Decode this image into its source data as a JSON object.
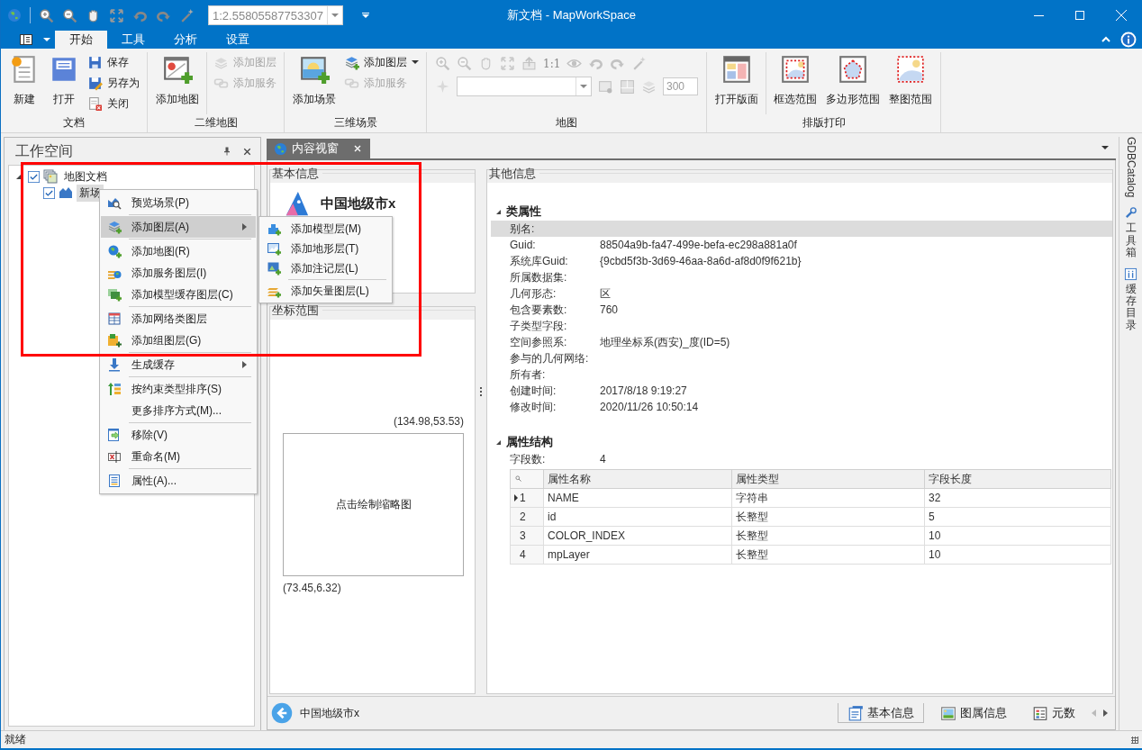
{
  "window": {
    "title": "新文档 - MapWorkSpace"
  },
  "quick_access": {
    "scale": "1:2.55805587753307"
  },
  "ribbon": {
    "tabs": [
      {
        "label": "开始",
        "selected": true
      },
      {
        "label": "工具",
        "selected": false
      },
      {
        "label": "分析",
        "selected": false
      },
      {
        "label": "设置",
        "selected": false
      }
    ],
    "groups": [
      {
        "title": "文档",
        "kind": "buttons",
        "items": [
          {
            "label": "新建",
            "kind": "large",
            "disabled": false,
            "dropdown": false
          },
          {
            "label": "打开",
            "kind": "large",
            "disabled": false,
            "dropdown": false
          },
          {
            "label": "保存",
            "kind": "small",
            "disabled": false,
            "dropdown": false
          },
          {
            "label": "另存为",
            "kind": "small",
            "disabled": false,
            "dropdown": false
          },
          {
            "label": "关闭",
            "kind": "small",
            "disabled": false,
            "dropdown": false
          }
        ]
      },
      {
        "title": "二维地图",
        "kind": "buttons",
        "items": [
          {
            "label": "添加地图",
            "kind": "large",
            "disabled": false,
            "dropdown": false
          },
          {
            "label": "添加图层",
            "kind": "small",
            "disabled": true,
            "dropdown": false
          },
          {
            "label": "添加服务",
            "kind": "small",
            "disabled": true,
            "dropdown": false
          }
        ]
      },
      {
        "title": "三维场景",
        "kind": "buttons",
        "items": [
          {
            "label": "添加场景",
            "kind": "large",
            "disabled": false,
            "dropdown": false
          },
          {
            "label": "添加图层",
            "kind": "small",
            "disabled": false,
            "dropdown": true
          },
          {
            "label": "添加服务",
            "kind": "small",
            "disabled": true,
            "dropdown": false
          }
        ]
      },
      {
        "title": "地图",
        "kind": "tools",
        "ratio_label": "1:1",
        "field_value": "300",
        "disabled": true
      },
      {
        "title": "排版打印",
        "kind": "buttons",
        "items": [
          {
            "label": "打开版面",
            "kind": "large",
            "disabled": false,
            "dropdown": false
          },
          {
            "label": "框选范围",
            "kind": "large",
            "disabled": false,
            "dropdown": false
          },
          {
            "label": "多边形范围",
            "kind": "large",
            "disabled": false,
            "dropdown": false
          },
          {
            "label": "整图范围",
            "kind": "large",
            "disabled": false,
            "dropdown": false
          }
        ]
      }
    ]
  },
  "workspace": {
    "title": "工作空间",
    "tree": [
      {
        "label": "地图文档",
        "checked": true,
        "expanded": true,
        "selected": false,
        "children": [
          {
            "label": "新场",
            "checked": true,
            "selected": true
          }
        ]
      }
    ]
  },
  "context_menu": {
    "groups": [
      [
        {
          "label": "预览场景(P)",
          "selected": false,
          "submenu": false
        }
      ],
      [
        {
          "label": "添加图层(A)",
          "selected": true,
          "submenu": true
        }
      ],
      [
        {
          "label": "添加地图(R)",
          "selected": false,
          "submenu": false
        },
        {
          "label": "添加服务图层(I)",
          "selected": false,
          "submenu": false
        },
        {
          "label": "添加模型缓存图层(C)",
          "selected": false,
          "submenu": false
        }
      ],
      [
        {
          "label": "添加网络类图层",
          "selected": false,
          "submenu": false
        },
        {
          "label": "添加组图层(G)",
          "selected": false,
          "submenu": false
        }
      ],
      [
        {
          "label": "生成缓存",
          "selected": false,
          "submenu": true
        }
      ],
      [
        {
          "label": "按约束类型排序(S)",
          "selected": false,
          "submenu": false
        },
        {
          "label": "更多排序方式(M)...",
          "selected": false,
          "submenu": false
        }
      ],
      [
        {
          "label": "移除(V)",
          "selected": false,
          "submenu": false
        },
        {
          "label": "重命名(M)",
          "selected": false,
          "submenu": false
        }
      ],
      [
        {
          "label": "属性(A)...",
          "selected": false,
          "submenu": false
        }
      ]
    ]
  },
  "submenu": {
    "groups": [
      [
        {
          "label": "添加模型层(M)",
          "selected": false
        },
        {
          "label": "添加地形层(T)",
          "selected": false
        },
        {
          "label": "添加注记层(L)",
          "selected": false
        }
      ],
      [
        {
          "label": "添加矢量图层(L)",
          "selected": false
        }
      ]
    ]
  },
  "content_view": {
    "tab": {
      "label": "内容视窗",
      "selected": true
    },
    "basic_info": {
      "title": "基本信息",
      "name": "中国地级市x"
    },
    "extent": {
      "title": "坐标范围",
      "max": "(134.98,53.53)",
      "thumbnail_button": "点击绘制缩略图",
      "min": "(73.45,6.32)"
    },
    "other_info": {
      "title": "其他信息",
      "sections": [
        {
          "title": "类属性",
          "expanded": true,
          "rows": [
            {
              "label": "别名:",
              "selected": true
            },
            {
              "label": "Guid:",
              "value": "88504a9b-fa47-499e-befa-ec298a881a0f",
              "selected": false
            },
            {
              "label": "系统库Guid:",
              "value": "{9cbd5f3b-3d69-46aa-8a6d-af8d0f9f621b}",
              "selected": false
            },
            {
              "label": "所属数据集:",
              "selected": false
            },
            {
              "label": "几何形态:",
              "value": "区",
              "selected": false
            },
            {
              "label": "包含要素数:",
              "value": "760",
              "selected": false
            },
            {
              "label": "子类型字段:",
              "selected": false
            },
            {
              "label": "空间参照系:",
              "value": "地理坐标系(西安)_度(ID=5)",
              "selected": false
            },
            {
              "label": "参与的几何网络:",
              "selected": false
            },
            {
              "label": "所有者:",
              "selected": false
            },
            {
              "label": "创建时间:",
              "value": "2017/8/18 9:19:27",
              "selected": false
            },
            {
              "label": "修改时间:",
              "value": "2020/11/26 10:50:14",
              "selected": false
            }
          ]
        },
        {
          "title": "属性结构",
          "expanded": true,
          "rows": [
            {
              "label": "字段数:",
              "value": "4",
              "selected": false
            }
          ],
          "table": {
            "columns": [
              "属性名称",
              "属性类型",
              "字段长度"
            ],
            "rows": [
              {
                "index": "1",
                "current": true,
                "cells": [
                  "NAME",
                  "字符串",
                  "32"
                ]
              },
              {
                "index": "2",
                "current": false,
                "cells": [
                  "id",
                  "长整型",
                  "5"
                ]
              },
              {
                "index": "3",
                "current": false,
                "cells": [
                  "COLOR_INDEX",
                  "长整型",
                  "10"
                ]
              },
              {
                "index": "4",
                "current": false,
                "cells": [
                  "mpLayer",
                  "长整型",
                  "10"
                ]
              }
            ]
          }
        }
      ]
    },
    "footer": {
      "name": "中国地级市x",
      "tabs": [
        {
          "label": "基本信息",
          "selected": true
        },
        {
          "label": "图属信息",
          "selected": false
        },
        {
          "label": "元数",
          "selected": false
        }
      ]
    }
  },
  "side_tabs": [
    {
      "label": "GDBCatalog",
      "kind": "latin"
    },
    {
      "label": "工具箱",
      "kind": "cjk"
    },
    {
      "label": "缓存目录",
      "kind": "cjk"
    }
  ],
  "status_bar": {
    "text": "就绪"
  }
}
